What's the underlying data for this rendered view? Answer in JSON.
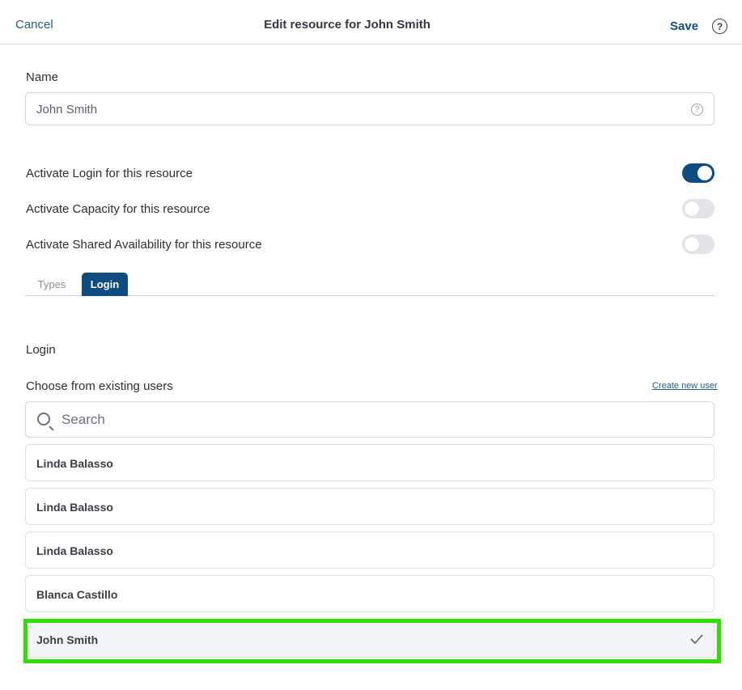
{
  "header": {
    "cancel_label": "Cancel",
    "title": "Edit resource for John Smith",
    "save_label": "Save",
    "help_icon": "?"
  },
  "name_field": {
    "label": "Name",
    "value": "John Smith",
    "help_icon": "?"
  },
  "toggles": [
    {
      "label": "Activate Login for this resource",
      "state": "on"
    },
    {
      "label": "Activate Capacity for this resource",
      "state": "off"
    },
    {
      "label": "Activate Shared Availability for this resource",
      "state": "off"
    }
  ],
  "tabs": [
    {
      "label": "Types",
      "active": false
    },
    {
      "label": "Login",
      "active": true
    }
  ],
  "login_section": {
    "heading": "Login",
    "choose_label": "Choose from existing users",
    "create_link": "Create new user",
    "search_placeholder": "Search"
  },
  "users": [
    {
      "name": "Linda Balasso",
      "selected": false
    },
    {
      "name": "Linda Balasso",
      "selected": false
    },
    {
      "name": "Linda Balasso",
      "selected": false
    },
    {
      "name": "Blanca Castillo",
      "selected": false
    },
    {
      "name": "John Smith",
      "selected": true
    }
  ],
  "colors": {
    "accent": "#0f4c81",
    "link": "#1f5f8b",
    "highlight": "#2ee000"
  }
}
